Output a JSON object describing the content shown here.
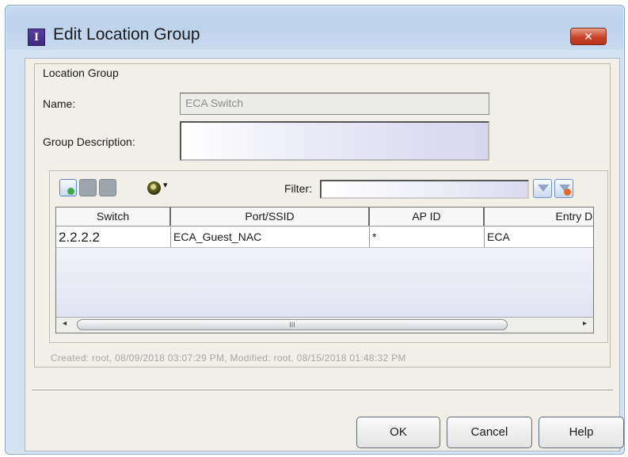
{
  "window": {
    "title": "Edit Location Group",
    "close_label": "✕"
  },
  "group": {
    "legend": "Location Group",
    "name_label": "Name:",
    "name_value": "ECA Switch",
    "description_label": "Group Description:",
    "description_value": ""
  },
  "toolbar": {
    "filter_label": "Filter:",
    "filter_value": "",
    "refresh_menu_glyph": "▾"
  },
  "table": {
    "columns": [
      "Switch",
      "Port/SSID",
      "AP ID",
      "Entry Desc"
    ],
    "rows": [
      [
        "2.2.2.2",
        "ECA_Guest_NAC",
        "*",
        "ECA"
      ]
    ]
  },
  "scrollbar": {
    "left_arrow": "◂",
    "right_arrow": "▸",
    "grip": "III"
  },
  "meta": {
    "created_modified": "Created: root, 08/09/2018 03:07:29 PM, Modified: root, 08/15/2018 01:48:32 PM"
  },
  "buttons": {
    "ok": "OK",
    "cancel": "Cancel",
    "help": "Help"
  },
  "icons": {
    "title": "location-group-icon",
    "add": "add-entry-icon",
    "edit": "edit-entry-icon",
    "delete": "delete-entry-icon",
    "refresh": "refresh-icon",
    "apply_filter": "filter-icon",
    "clear_filter": "clear-filter-icon"
  }
}
